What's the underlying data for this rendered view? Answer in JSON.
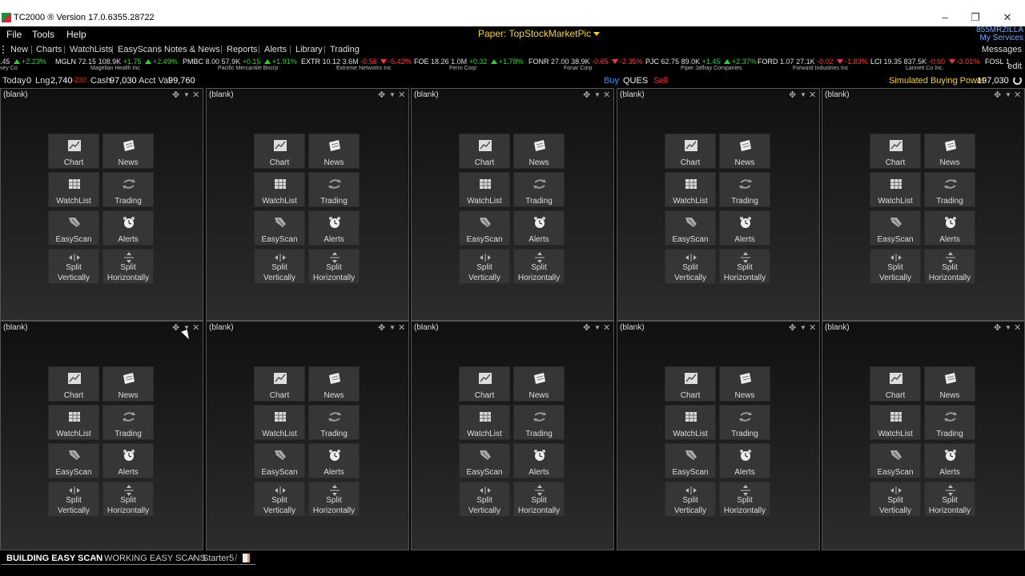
{
  "window": {
    "title": "TC2000 ® Version 17.0.6355.28722",
    "minimize_icon": "minimize-icon",
    "maximize_icon": "restore-icon",
    "close_icon": "close-icon"
  },
  "menu": {
    "items": [
      "File",
      "Tools",
      "Help"
    ],
    "paper_account": "Paper: TopStockMarketPic",
    "username": "855MRZILLA",
    "my_services": "My Services"
  },
  "toolbar": {
    "items": [
      "New",
      "Charts",
      "WatchLists",
      "EasyScans",
      "Notes & News",
      "Reports",
      "Alerts",
      "Library",
      "Trading"
    ],
    "messages": "Messages"
  },
  "ticker": {
    "items": [
      {
        "symbol": "",
        "price": ".45",
        "vol": "",
        "change": "",
        "dir": "up",
        "pct": "+2.23%",
        "name": "vey Co"
      },
      {
        "symbol": "MGLN",
        "price": "72.15",
        "vol": "108.9K",
        "change": "+1.75",
        "dir": "up",
        "pct": "+2.49%",
        "name": "Magellan Health Inc"
      },
      {
        "symbol": "PMBC",
        "price": "8.00",
        "vol": "57.9K",
        "change": "+0.15",
        "dir": "up",
        "pct": "+1.91%",
        "name": "Pacific Mercantile Bncrp"
      },
      {
        "symbol": "EXTR",
        "price": "10.12",
        "vol": "3.6M",
        "change": "-0.58",
        "dir": "dn",
        "pct": "-5.42%",
        "name": "Extreme Networks Inc"
      },
      {
        "symbol": "FOE",
        "price": "18.26",
        "vol": "1.0M",
        "change": "+0.32",
        "dir": "up",
        "pct": "+1.78%",
        "name": "Ferro Corp"
      },
      {
        "symbol": "FONR",
        "price": "27.00",
        "vol": "38.9K",
        "change": "-0.65",
        "dir": "dn",
        "pct": "-2.35%",
        "name": "Fonar Corp"
      },
      {
        "symbol": "PJC",
        "price": "62.75",
        "vol": "89.0K",
        "change": "+1.45",
        "dir": "up",
        "pct": "+2.37%",
        "name": "Piper Jaffray Companies"
      },
      {
        "symbol": "FORD",
        "price": "1.07",
        "vol": "27.1K",
        "change": "-0.02",
        "dir": "dn",
        "pct": "-1.83%",
        "name": "Forward Industries Inc"
      },
      {
        "symbol": "LCI",
        "price": "19.35",
        "vol": "837.5K",
        "change": "-0.60",
        "dir": "dn",
        "pct": "-3.01%",
        "name": "Lannett Co Inc."
      },
      {
        "symbol": "FOSL",
        "price": "1",
        "vol": "",
        "change": "",
        "dir": "",
        "pct": "",
        "name": ""
      }
    ],
    "edit": "edit"
  },
  "account": {
    "today_label": "Today",
    "today_value": "0",
    "lng_label": "Lng",
    "lng_value": "2,740",
    "lng_neg": "-230",
    "cash_label": "Cash",
    "cash_value": "97,030",
    "acct_label": "Acct Val",
    "acct_value": "99,760",
    "buy": "Buy",
    "ques": "QUES",
    "sell": "Sell",
    "sbp_label": "Simulated Buying Power",
    "sbp_value": "197,030"
  },
  "pane": {
    "title": "(blank)",
    "tiles": {
      "chart": "Chart",
      "news": "News",
      "watchlist": "WatchList",
      "trading": "Trading",
      "easyscan": "EasyScan",
      "alerts": "Alerts",
      "split_v": [
        "Split",
        "Vertically"
      ],
      "split_h": [
        "Split",
        "Horizontally"
      ]
    }
  },
  "tabs": {
    "items": [
      "BUILDING EASY SCAN",
      "WORKING EASY SCANS",
      "Starter5"
    ],
    "active": 0
  }
}
